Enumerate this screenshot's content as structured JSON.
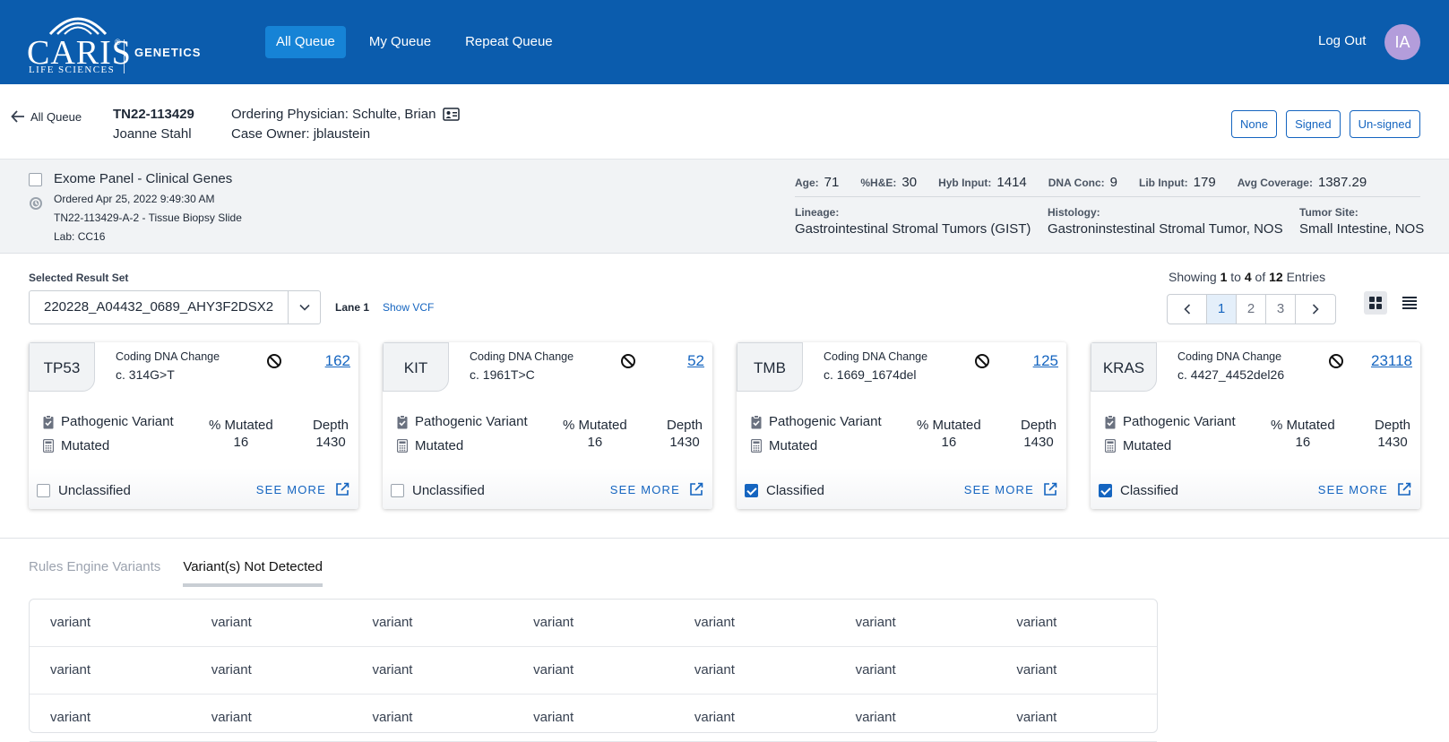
{
  "brand": {
    "name": "CARIS",
    "registered": "®",
    "tagline": "LIFE SCIENCES",
    "product": "GENETICS"
  },
  "nav": {
    "tabs": [
      {
        "label": "All Queue",
        "active": true
      },
      {
        "label": "My Queue",
        "active": false
      },
      {
        "label": "Repeat Queue",
        "active": false
      }
    ],
    "logout_label": "Log Out",
    "user_initials": "IA"
  },
  "case": {
    "back_label": "All Queue",
    "case_id": "TN22-113429",
    "patient_name": "Joanne Stahl",
    "ordering_physician": "Ordering Physician: Schulte, Brian",
    "case_owner": "Case Owner: jblaustein",
    "sign_filters": [
      "None",
      "Signed",
      "Un-signed"
    ]
  },
  "order": {
    "title": "Exome Panel - Clinical Genes",
    "ordered": "Ordered Apr 25, 2022 9:49:30 AM",
    "specimen": "TN22-113429-A-2 - Tissue Biopsy Slide",
    "lab": "Lab: CC16",
    "metrics": [
      {
        "label": "Age:",
        "value": "71"
      },
      {
        "label": "%H&E:",
        "value": "30"
      },
      {
        "label": "Hyb Input:",
        "value": "1414"
      },
      {
        "label": "DNA Conc:",
        "value": "9"
      },
      {
        "label": "Lib Input:",
        "value": "179"
      },
      {
        "label": "Avg Coverage:",
        "value": "1387.29"
      }
    ],
    "lineage_label": "Lineage:",
    "lineage": "Gastrointestinal Stromal Tumors (GIST)",
    "histology_label": "Histology:",
    "histology": "Gastroninstestinal Stromal Tumor, NOS",
    "tumor_site_label": "Tumor Site:",
    "tumor_site": "Small Intestine, NOS"
  },
  "result_set": {
    "label": "Selected Result Set",
    "value": "220228_A04432_0689_AHY3F2DSX2",
    "lane": "Lane 1",
    "show_vcf": "Show VCF"
  },
  "pagination": {
    "showing_prefix": "Showing",
    "from": "1",
    "to_word": "to",
    "to": "4",
    "of_word": "of",
    "total": "12",
    "entries_word": "Entries",
    "pages": [
      "1",
      "2",
      "3"
    ],
    "current": "1"
  },
  "cards": [
    {
      "gene": "TP53",
      "cdc_label": "Coding DNA Change",
      "cdc": "c. 314G>T",
      "count": "162",
      "significance": "Pathogenic Variant",
      "status": "Mutated",
      "pct_label": "% Mutated",
      "pct": "16",
      "depth_label": "Depth",
      "depth": "1430",
      "classification": "Unclassified",
      "classified": false,
      "see_more": "SEE MORE"
    },
    {
      "gene": "KIT",
      "cdc_label": "Coding DNA Change",
      "cdc": "c. 1961T>C",
      "count": "52",
      "significance": "Pathogenic Variant",
      "status": "Mutated",
      "pct_label": "% Mutated",
      "pct": "16",
      "depth_label": "Depth",
      "depth": "1430",
      "classification": "Unclassified",
      "classified": false,
      "see_more": "SEE MORE"
    },
    {
      "gene": "TMB",
      "cdc_label": "Coding DNA Change",
      "cdc": "c. 1669_1674del",
      "count": "125",
      "significance": "Pathogenic Variant",
      "status": "Mutated",
      "pct_label": "% Mutated",
      "pct": "16",
      "depth_label": "Depth",
      "depth": "1430",
      "classification": "Classified",
      "classified": true,
      "see_more": "SEE MORE"
    },
    {
      "gene": "KRAS",
      "cdc_label": "Coding DNA Change",
      "cdc": "c. 4427_4452del26",
      "count": "23118",
      "significance": "Pathogenic Variant",
      "status": "Mutated",
      "pct_label": "% Mutated",
      "pct": "16",
      "depth_label": "Depth",
      "depth": "1430",
      "classification": "Classified",
      "classified": true,
      "see_more": "SEE MORE"
    }
  ],
  "variant_tabs": [
    {
      "label": "Rules Engine Variants",
      "active": false
    },
    {
      "label": "Variant(s) Not Detected",
      "active": true
    }
  ],
  "variant_table": {
    "rows": [
      [
        "variant",
        "variant",
        "variant",
        "variant",
        "variant",
        "variant",
        "variant"
      ],
      [
        "variant",
        "variant",
        "variant",
        "variant",
        "variant",
        "variant",
        "variant"
      ],
      [
        "variant",
        "variant",
        "variant",
        "variant",
        "variant",
        "variant",
        "variant"
      ]
    ]
  },
  "colors": {
    "header_bg": "#0b5cad",
    "nav_active": "#1683d6",
    "link": "#1565c0",
    "avatar": "#b39ddb"
  }
}
